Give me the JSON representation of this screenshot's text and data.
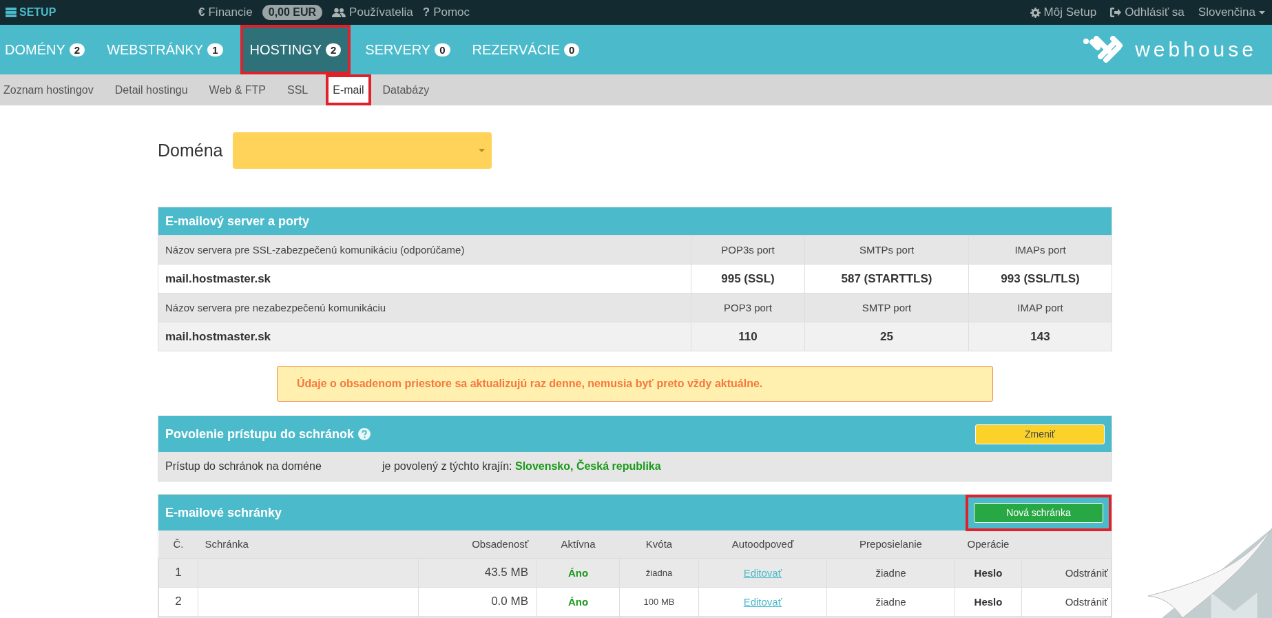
{
  "topbar": {
    "brand": "SETUP",
    "items": [
      {
        "kind": "glyph",
        "icon": "€",
        "label": "Financie"
      },
      {
        "kind": "badge",
        "label": "0,00 EUR"
      },
      {
        "kind": "users",
        "label": "Používatelia"
      },
      {
        "kind": "glyph",
        "icon": "?",
        "label": "Pomoc"
      }
    ],
    "right": [
      {
        "kind": "gear",
        "label": "Môj Setup"
      },
      {
        "kind": "signout",
        "label": "Odhlásiť sa"
      },
      {
        "kind": "dropdown",
        "label": "Slovenčina"
      }
    ]
  },
  "nav": {
    "tabs": [
      {
        "label": "DOMÉNY",
        "count": "2",
        "selected": false,
        "highlighted": false
      },
      {
        "label": "WEBSTRÁNKY",
        "count": "1",
        "selected": false,
        "highlighted": false
      },
      {
        "label": "HOSTINGY",
        "count": "2",
        "selected": true,
        "highlighted": true
      },
      {
        "label": "SERVERY",
        "count": "0",
        "selected": false,
        "highlighted": false
      },
      {
        "label": "REZERVÁCIE",
        "count": "0",
        "selected": false,
        "highlighted": false
      }
    ],
    "logo": "**web**house"
  },
  "subnav": [
    {
      "label": "Zoznam hostingov",
      "selected": false,
      "highlighted": false
    },
    {
      "label": "Detail hostingu",
      "selected": false,
      "highlighted": false
    },
    {
      "label": "Web & FTP",
      "selected": false,
      "highlighted": false
    },
    {
      "label": "SSL",
      "selected": false,
      "highlighted": false
    },
    {
      "label": "E-mail",
      "selected": true,
      "highlighted": true
    },
    {
      "label": "Databázy",
      "selected": false,
      "highlighted": false
    }
  ],
  "domain": {
    "label": "Doména"
  },
  "server_panel": {
    "title": "E-mailový server a porty",
    "rows": [
      {
        "kind": "head",
        "cells": [
          "Názov servera pre SSL-zabezpečenú komunikáciu (odporúčame)",
          "POP3s port",
          "SMTPs port",
          "IMAPs port"
        ]
      },
      {
        "kind": "value",
        "cells": [
          "mail.hostmaster.sk",
          "995 (SSL)",
          "587 (STARTTLS)",
          "993 (SSL/TLS)"
        ]
      },
      {
        "kind": "head",
        "cells": [
          "Názov servera pre nezabezpečenú komunikáciu",
          "POP3 port",
          "SMTP port",
          "IMAP port"
        ]
      },
      {
        "kind": "value",
        "cells": [
          "mail.hostmaster.sk",
          "110",
          "25",
          "143"
        ]
      }
    ]
  },
  "notice": "Údaje o obsadenom priestore sa aktualizujú raz denne, nemusia byť preto vždy aktuálne.",
  "access_panel": {
    "title": "Povolenie prístupu do schránok",
    "button": "Zmeniť",
    "label": "Prístup do schránok na doméne",
    "text": "je povolený z týchto krajín: **Slovensko, Česká republika**"
  },
  "mailboxes": {
    "title": "E-mailové schránky",
    "button": {
      "label": "Nová schránka",
      "highlighted": true
    },
    "columns": [
      "Č.",
      "Schránka",
      "Obsadenosť",
      "Aktívna",
      "Kvóta",
      "Autoodpoveď",
      "Preposielanie",
      "Operácie"
    ],
    "rows": [
      {
        "number": "1",
        "usage": "43.5 MB",
        "active": "Áno",
        "quota": "žiadna",
        "autoreply": "Editovať",
        "forwarding": "žiadne",
        "password": "Heslo",
        "delete": "Odstrániť"
      },
      {
        "number": "2",
        "usage": "0.0 MB",
        "active": "Áno",
        "quota": "100 MB",
        "autoreply": "Editovať",
        "forwarding": "žiadne",
        "password": "Heslo",
        "delete": "Odstrániť"
      }
    ]
  }
}
